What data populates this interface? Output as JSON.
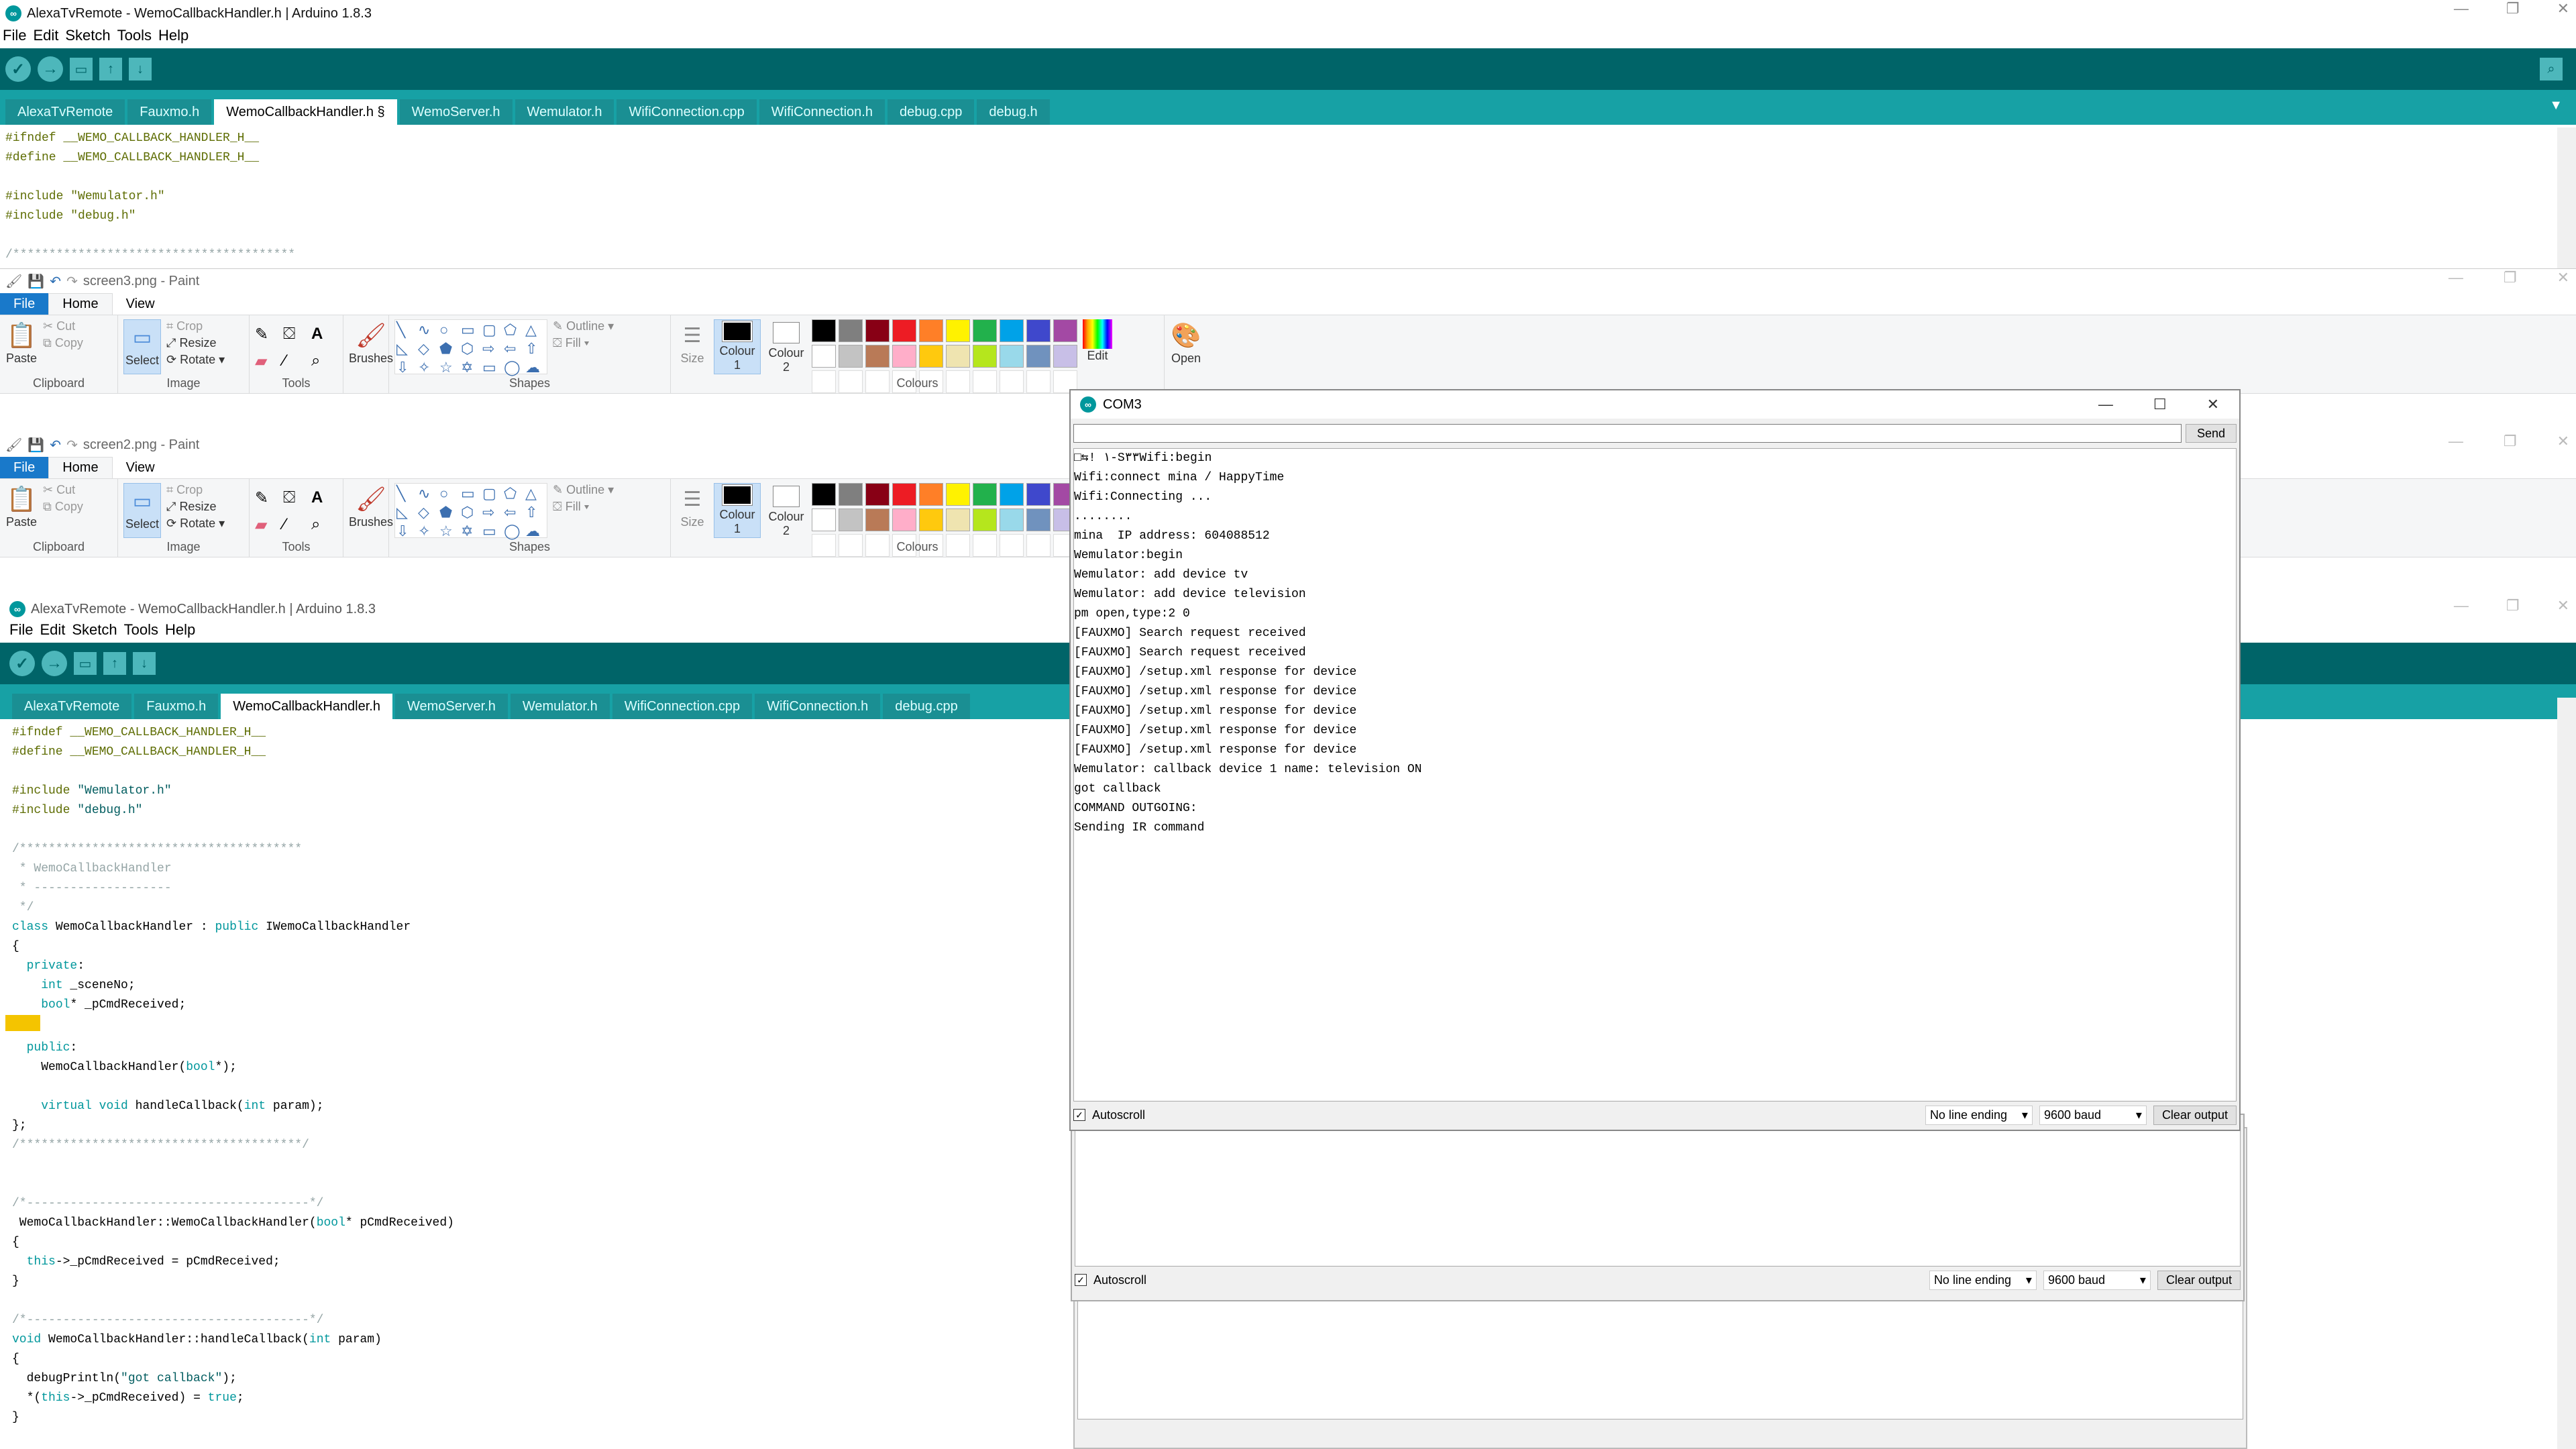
{
  "arduino_top": {
    "title": "AlexaTvRemote - WemoCallbackHandler.h | Arduino 1.8.3",
    "menu": [
      "File",
      "Edit",
      "Sketch",
      "Tools",
      "Help"
    ],
    "tabs": [
      "AlexaTvRemote",
      "Fauxmo.h",
      "WemoCallbackHandler.h §",
      "WemoServer.h",
      "Wemulator.h",
      "WifiConnection.cpp",
      "WifiConnection.h",
      "debug.cpp",
      "debug.h"
    ],
    "code": [
      "#ifndef __WEMO_CALLBACK_HANDLER_H__",
      "#define __WEMO_CALLBACK_HANDLER_H__",
      "",
      "#include \"Wemulator.h\"",
      "#include \"debug.h\"",
      "",
      "/***************************************"
    ]
  },
  "paint1": {
    "title": "screen3.png - Paint",
    "tabs": [
      "File",
      "Home",
      "View"
    ]
  },
  "paint2": {
    "title": "screen2.png - Paint",
    "tabs": [
      "File",
      "Home",
      "View"
    ]
  },
  "paint_labels": {
    "paste": "Paste",
    "cut": "Cut",
    "copy": "Copy",
    "select": "Select",
    "crop": "Crop",
    "resize": "Resize",
    "rotate": "Rotate",
    "brushes": "Brushes",
    "outline": "Outline",
    "fill": "Fill",
    "size": "Size",
    "colour1": "Colour 1",
    "colour2": "Colour 2",
    "edit": "Edit",
    "open": "Open",
    "groups": [
      "Clipboard",
      "Image",
      "Tools",
      "Shapes",
      "Colours"
    ]
  },
  "palette": [
    "#000000",
    "#7f7f7f",
    "#880015",
    "#ed1c24",
    "#ff7f27",
    "#fff200",
    "#22b14c",
    "#00a2e8",
    "#3f48cc",
    "#a349a4",
    "#ffffff",
    "#c3c3c3",
    "#b97a57",
    "#ffaec9",
    "#ffc90e",
    "#efe4b0",
    "#b5e61d",
    "#99d9ea",
    "#7092be",
    "#c8bfe7"
  ],
  "arduino_main": {
    "title": "AlexaTvRemote - WemoCallbackHandler.h | Arduino 1.8.3",
    "menu": [
      "File",
      "Edit",
      "Sketch",
      "Tools",
      "Help"
    ],
    "tabs": [
      "AlexaTvRemote",
      "Fauxmo.h",
      "WemoCallbackHandler.h",
      "WemoServer.h",
      "Wemulator.h",
      "WifiConnection.cpp",
      "WifiConnection.h",
      "debug.cpp"
    ]
  },
  "serial": {
    "title": "COM3",
    "send": "Send",
    "lines": [
      "□⇆! ١-S٣٣Wifi:begin",
      "Wifi:connect mina / HappyTime",
      "Wifi:Connecting ...",
      "........",
      "mina  IP address: 604088512",
      "Wemulator:begin",
      "Wemulator: add device tv",
      "Wemulator: add device television",
      "pm open,type:2 0",
      "[FAUXMO] Search request received",
      "[FAUXMO] Search request received",
      "[FAUXMO] /setup.xml response for device",
      "[FAUXMO] /setup.xml response for device",
      "[FAUXMO] /setup.xml response for device",
      "[FAUXMO] /setup.xml response for device",
      "[FAUXMO] /setup.xml response for device",
      "Wemulator: callback device 1 name: television ON",
      "got callback",
      "COMMAND OUTGOING:",
      "Sending IR command"
    ],
    "autoscroll": "Autoscroll",
    "line_ending": "No line ending",
    "baud": "9600 baud",
    "clear": "Clear output"
  },
  "colors": {
    "arduino_dark": "#006468",
    "arduino_tabs": "#17a1a5",
    "highlight": "#f4c400"
  }
}
